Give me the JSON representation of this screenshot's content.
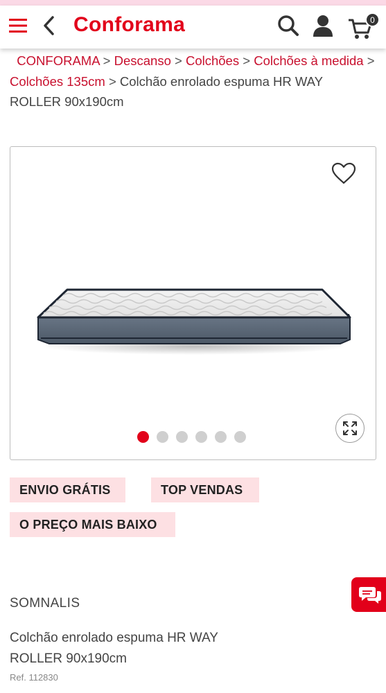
{
  "header": {
    "logo": "Conforama",
    "cart_count": "0",
    "brand_color": "#e2001a",
    "icons": [
      "hamburger-menu-icon",
      "back-chevron-icon",
      "search-icon",
      "user-icon",
      "cart-icon"
    ]
  },
  "breadcrumb": {
    "items": [
      "CONFORAMA",
      "Descanso",
      "Colchões",
      "Colchões à medida",
      "Colchões 135cm"
    ],
    "current": "Colchão enrolado espuma HR WAY ROLLER 90x190cm",
    "separator": ">"
  },
  "gallery": {
    "image_count": 6,
    "active_index": 0,
    "icons": [
      "heart-icon",
      "expand-icon"
    ]
  },
  "tags": [
    "ENVIO GRÁTIS",
    "TOP VENDAS",
    "O PREÇO MAIS BAIXO"
  ],
  "product": {
    "brand": "SOMNALIS",
    "title": "Colchão enrolado espuma HR WAY ROLLER 90x190cm",
    "ref": "Ref. 112830"
  },
  "chat": {
    "icon": "chat-bubbles-icon"
  }
}
